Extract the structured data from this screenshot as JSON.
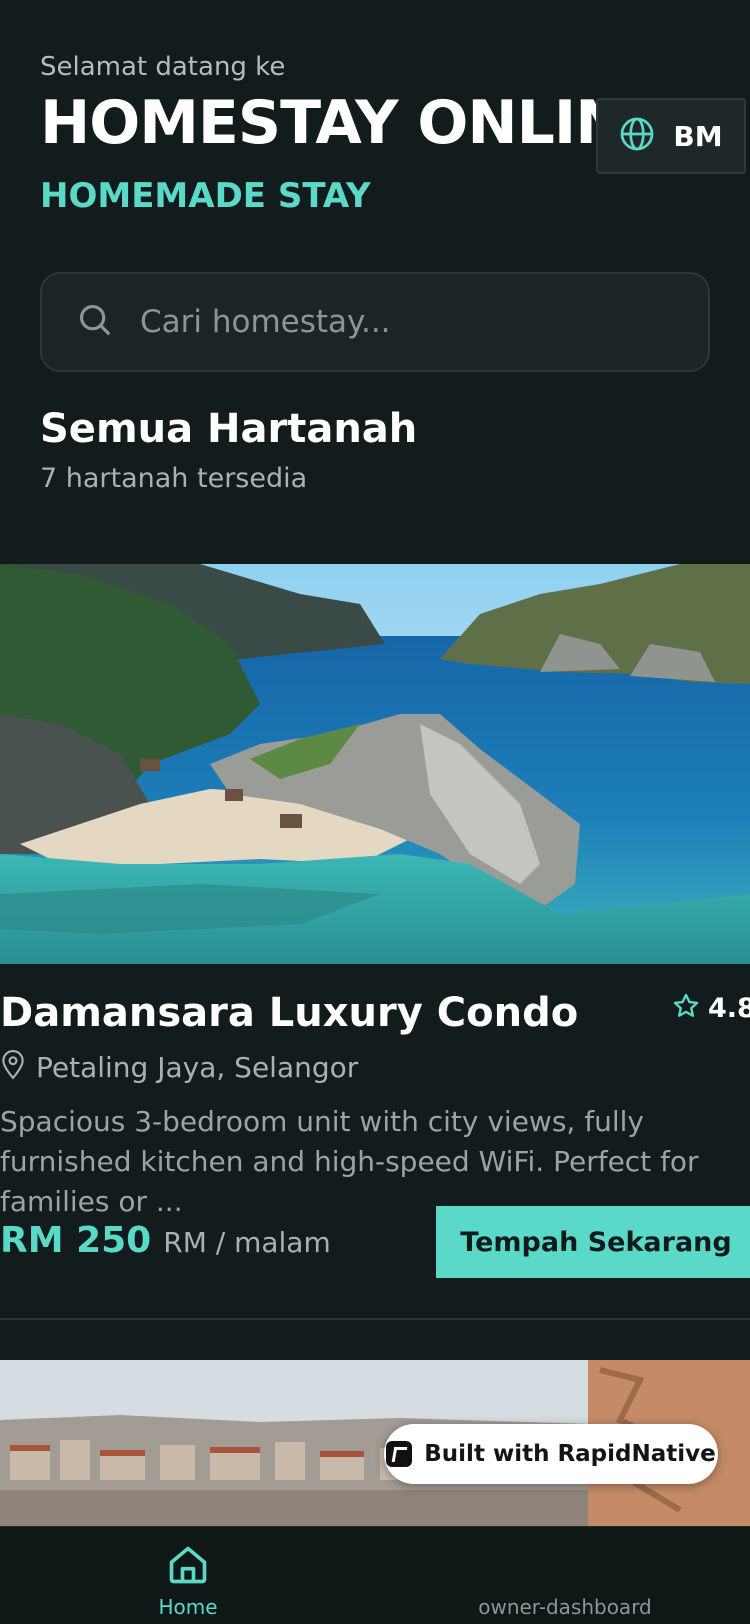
{
  "header": {
    "greeting": "Selamat datang ke",
    "title": "HOMESTAY ONLINE",
    "subtitle": "HOMEMADE STAY",
    "language_label": "BM"
  },
  "search": {
    "placeholder": "Cari homestay..."
  },
  "section": {
    "title": "Semua Hartanah",
    "count_text": "7 hartanah tersedia"
  },
  "properties": [
    {
      "name": "Damansara Luxury Condo",
      "rating": "4.8",
      "location": "Petaling Jaya, Selangor",
      "description": "Spacious 3-bedroom unit with city views, fully furnished kitchen and high-speed WiFi. Perfect for families or ...",
      "price": "RM 250",
      "price_unit": "RM / malam",
      "book_label": "Tempah Sekarang"
    }
  ],
  "badge": {
    "label": "Built with RapidNative"
  },
  "tabbar": {
    "home_label": "Home",
    "owner_label": "owner-dashboard"
  },
  "colors": {
    "background": "#131c1c",
    "accent": "#5ad9c8",
    "muted_text": "#a8b2b2"
  }
}
